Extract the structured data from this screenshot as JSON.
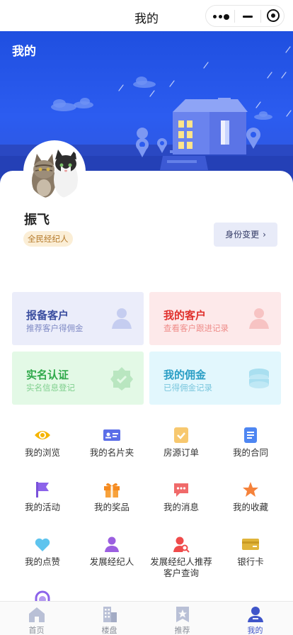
{
  "topnav": {
    "title": "我的"
  },
  "banner": {
    "heading": "我的"
  },
  "profile": {
    "name": "振飞",
    "role": "全民经纪人",
    "identity_button": "身份变更",
    "identity_chevron": "›"
  },
  "quick_cards": [
    {
      "title": "报备客户",
      "subtitle": "推荐客户得佣金",
      "icon": "person-icon"
    },
    {
      "title": "我的客户",
      "subtitle": "查看客户跟进记录",
      "icon": "person-icon"
    },
    {
      "title": "实名认证",
      "subtitle": "实名信息登记",
      "icon": "verified-badge-icon"
    },
    {
      "title": "我的佣金",
      "subtitle": "已得佣金记录",
      "icon": "coins-stack-icon"
    }
  ],
  "grid": [
    {
      "label": "我的浏览",
      "icon": "eye-icon"
    },
    {
      "label": "我的名片夹",
      "icon": "business-card-icon"
    },
    {
      "label": "房源订单",
      "icon": "order-check-icon"
    },
    {
      "label": "我的合同",
      "icon": "document-icon"
    },
    {
      "label": "我的活动",
      "icon": "flag-icon"
    },
    {
      "label": "我的奖品",
      "icon": "gift-icon"
    },
    {
      "label": "我的消息",
      "icon": "message-icon"
    },
    {
      "label": "我的收藏",
      "icon": "star-icon"
    },
    {
      "label": "我的点赞",
      "icon": "heart-icon"
    },
    {
      "label": "发展经纪人",
      "icon": "user-icon"
    },
    {
      "label": "发展经纪人推荐客户查询",
      "icon": "user-search-icon"
    },
    {
      "label": "银行卡",
      "icon": "bank-card-icon"
    }
  ],
  "tabbar": [
    {
      "label": "首页",
      "icon": "home-icon"
    },
    {
      "label": "楼盘",
      "icon": "buildings-icon"
    },
    {
      "label": "推荐",
      "icon": "bookmark-star-icon"
    },
    {
      "label": "我的",
      "icon": "user-icon",
      "active": true
    }
  ],
  "colors": {
    "brand_blue": "#2c5cf0",
    "tab_active": "#3f55c9",
    "report_title": "#3b4ea0",
    "customer_title": "#e0312d",
    "verify_title": "#2fa94a",
    "commission_title": "#2a9ec5"
  }
}
